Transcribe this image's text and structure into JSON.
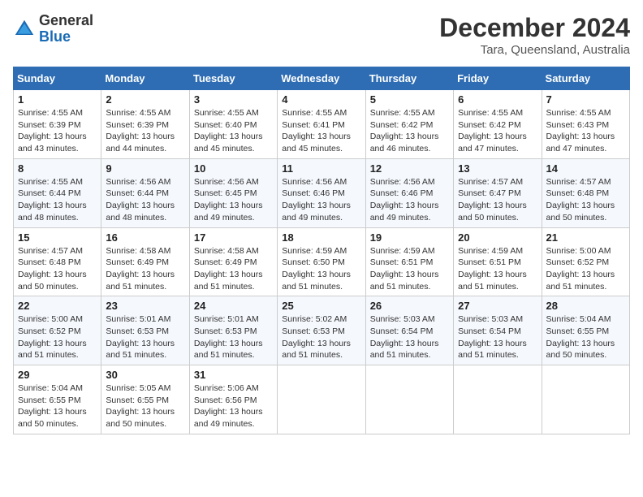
{
  "header": {
    "logo_general": "General",
    "logo_blue": "Blue",
    "month_title": "December 2024",
    "subtitle": "Tara, Queensland, Australia"
  },
  "weekdays": [
    "Sunday",
    "Monday",
    "Tuesday",
    "Wednesday",
    "Thursday",
    "Friday",
    "Saturday"
  ],
  "weeks": [
    [
      {
        "day": "1",
        "sunrise": "4:55 AM",
        "sunset": "6:39 PM",
        "daylight": "13 hours and 43 minutes."
      },
      {
        "day": "2",
        "sunrise": "4:55 AM",
        "sunset": "6:39 PM",
        "daylight": "13 hours and 44 minutes."
      },
      {
        "day": "3",
        "sunrise": "4:55 AM",
        "sunset": "6:40 PM",
        "daylight": "13 hours and 45 minutes."
      },
      {
        "day": "4",
        "sunrise": "4:55 AM",
        "sunset": "6:41 PM",
        "daylight": "13 hours and 45 minutes."
      },
      {
        "day": "5",
        "sunrise": "4:55 AM",
        "sunset": "6:42 PM",
        "daylight": "13 hours and 46 minutes."
      },
      {
        "day": "6",
        "sunrise": "4:55 AM",
        "sunset": "6:42 PM",
        "daylight": "13 hours and 47 minutes."
      },
      {
        "day": "7",
        "sunrise": "4:55 AM",
        "sunset": "6:43 PM",
        "daylight": "13 hours and 47 minutes."
      }
    ],
    [
      {
        "day": "8",
        "sunrise": "4:55 AM",
        "sunset": "6:44 PM",
        "daylight": "13 hours and 48 minutes."
      },
      {
        "day": "9",
        "sunrise": "4:56 AM",
        "sunset": "6:44 PM",
        "daylight": "13 hours and 48 minutes."
      },
      {
        "day": "10",
        "sunrise": "4:56 AM",
        "sunset": "6:45 PM",
        "daylight": "13 hours and 49 minutes."
      },
      {
        "day": "11",
        "sunrise": "4:56 AM",
        "sunset": "6:46 PM",
        "daylight": "13 hours and 49 minutes."
      },
      {
        "day": "12",
        "sunrise": "4:56 AM",
        "sunset": "6:46 PM",
        "daylight": "13 hours and 49 minutes."
      },
      {
        "day": "13",
        "sunrise": "4:57 AM",
        "sunset": "6:47 PM",
        "daylight": "13 hours and 50 minutes."
      },
      {
        "day": "14",
        "sunrise": "4:57 AM",
        "sunset": "6:48 PM",
        "daylight": "13 hours and 50 minutes."
      }
    ],
    [
      {
        "day": "15",
        "sunrise": "4:57 AM",
        "sunset": "6:48 PM",
        "daylight": "13 hours and 50 minutes."
      },
      {
        "day": "16",
        "sunrise": "4:58 AM",
        "sunset": "6:49 PM",
        "daylight": "13 hours and 51 minutes."
      },
      {
        "day": "17",
        "sunrise": "4:58 AM",
        "sunset": "6:49 PM",
        "daylight": "13 hours and 51 minutes."
      },
      {
        "day": "18",
        "sunrise": "4:59 AM",
        "sunset": "6:50 PM",
        "daylight": "13 hours and 51 minutes."
      },
      {
        "day": "19",
        "sunrise": "4:59 AM",
        "sunset": "6:51 PM",
        "daylight": "13 hours and 51 minutes."
      },
      {
        "day": "20",
        "sunrise": "4:59 AM",
        "sunset": "6:51 PM",
        "daylight": "13 hours and 51 minutes."
      },
      {
        "day": "21",
        "sunrise": "5:00 AM",
        "sunset": "6:52 PM",
        "daylight": "13 hours and 51 minutes."
      }
    ],
    [
      {
        "day": "22",
        "sunrise": "5:00 AM",
        "sunset": "6:52 PM",
        "daylight": "13 hours and 51 minutes."
      },
      {
        "day": "23",
        "sunrise": "5:01 AM",
        "sunset": "6:53 PM",
        "daylight": "13 hours and 51 minutes."
      },
      {
        "day": "24",
        "sunrise": "5:01 AM",
        "sunset": "6:53 PM",
        "daylight": "13 hours and 51 minutes."
      },
      {
        "day": "25",
        "sunrise": "5:02 AM",
        "sunset": "6:53 PM",
        "daylight": "13 hours and 51 minutes."
      },
      {
        "day": "26",
        "sunrise": "5:03 AM",
        "sunset": "6:54 PM",
        "daylight": "13 hours and 51 minutes."
      },
      {
        "day": "27",
        "sunrise": "5:03 AM",
        "sunset": "6:54 PM",
        "daylight": "13 hours and 51 minutes."
      },
      {
        "day": "28",
        "sunrise": "5:04 AM",
        "sunset": "6:55 PM",
        "daylight": "13 hours and 50 minutes."
      }
    ],
    [
      {
        "day": "29",
        "sunrise": "5:04 AM",
        "sunset": "6:55 PM",
        "daylight": "13 hours and 50 minutes."
      },
      {
        "day": "30",
        "sunrise": "5:05 AM",
        "sunset": "6:55 PM",
        "daylight": "13 hours and 50 minutes."
      },
      {
        "day": "31",
        "sunrise": "5:06 AM",
        "sunset": "6:56 PM",
        "daylight": "13 hours and 49 minutes."
      },
      null,
      null,
      null,
      null
    ]
  ]
}
